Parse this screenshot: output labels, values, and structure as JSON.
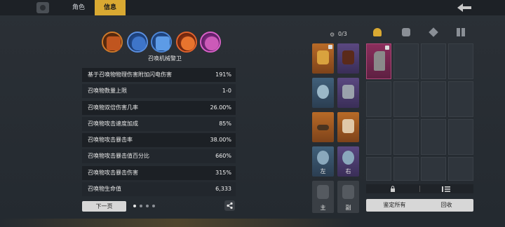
{
  "tabs": {
    "role": "角色",
    "info": "信息"
  },
  "skills": {
    "name": "召唤机械警卫",
    "icons": [
      "skill-fire-icon",
      "skill-shield-icon",
      "skill-lightning-icon",
      "skill-burst-icon",
      "skill-arcane-icon"
    ]
  },
  "stats": [
    {
      "label": "基于召唤物物理伤害附加闪电伤害",
      "value": "191%"
    },
    {
      "label": "召唤物数量上限",
      "value": "1-0"
    },
    {
      "label": "召唤物双倍伤害几率",
      "value": "26.00%"
    },
    {
      "label": "召唤物攻击速度加成",
      "value": "85%"
    },
    {
      "label": "召唤物攻击暴击率",
      "value": "38.00%"
    },
    {
      "label": "召唤物攻击暴击值百分比",
      "value": "660%"
    },
    {
      "label": "召唤物攻击暴击伤害",
      "value": "315%"
    },
    {
      "label": "召唤物生命值",
      "value": "6,333"
    }
  ],
  "pager": {
    "next": "下一页"
  },
  "equipment": {
    "counter": "0/3",
    "slot_labels": {
      "left": "左",
      "right": "右",
      "main": "主",
      "off": "副"
    }
  },
  "inventory": {
    "identify_all": "鉴定所有",
    "recycle": "回收"
  },
  "colors": {
    "accent": "#d9a932",
    "rarity_orange": "#b86a27",
    "rarity_purple": "#5a4880",
    "rarity_blue": "#41607a",
    "rarity_pink": "#8a2e5c"
  }
}
